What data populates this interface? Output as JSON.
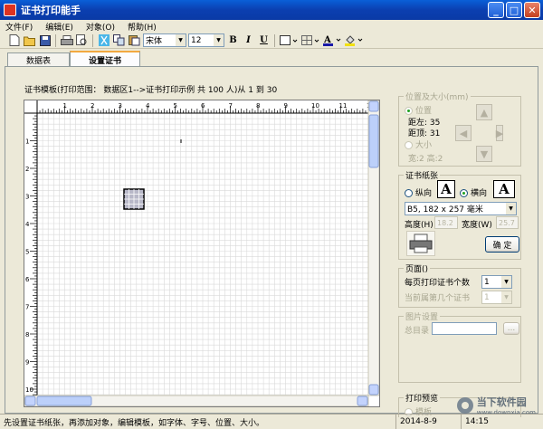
{
  "window": {
    "title": "证书打印能手"
  },
  "menu": [
    "文件(F)",
    "编辑(E)",
    "对象(O)",
    "帮助(H)"
  ],
  "toolbar": {
    "font_name": "宋体",
    "font_size": "12",
    "bold": "B",
    "italic": "I",
    "underline": "U",
    "font_color": "A"
  },
  "tabs": [
    {
      "label": "数据表"
    },
    {
      "label": "设置证书"
    }
  ],
  "template_info": "证书模板(打印范围： 数据区1-->证书打印示例 共 100 人)从 1 到 30",
  "ruler": {
    "h": [
      "1",
      "2",
      "3",
      "4",
      "5",
      "6",
      "7",
      "8",
      "9",
      "10",
      "11",
      "12"
    ],
    "v": [
      "1",
      "2",
      "3",
      "4",
      "5",
      "6",
      "7",
      "8",
      "9",
      "10"
    ]
  },
  "position_group": {
    "title": "位置及大小(mm)",
    "position_label": "位置",
    "left_label": "距左: 35",
    "top_label": "距顶: 31",
    "size_label": "大小",
    "size_value": "宽:2 高:2"
  },
  "paper_group": {
    "title": "证书纸张",
    "portrait_label": "纵向",
    "landscape_label": "横向",
    "paper_size": "B5, 182 x 257 毫米",
    "height_label": "高度(H)",
    "height_value": "18.2",
    "width_label": "宽度(W)",
    "width_value": "25.7",
    "ok_label": "确 定"
  },
  "page_group": {
    "title": "页面()",
    "per_page_label": "每页打印证书个数",
    "per_page_value": "1",
    "current_label": "当前属第几个证书",
    "current_value": "1"
  },
  "image_group": {
    "title": "图片设置",
    "dir_label": "总目录",
    "dir_value": "",
    "browse_label": "..."
  },
  "preview_group": {
    "title": "打印预览",
    "option": "模板"
  },
  "status": {
    "hint": "先设置证书纸张，再添加对象，编辑模板，如字体、字号、位置、大小。",
    "date": "2014-8-9",
    "time": "14:15"
  },
  "watermark": {
    "text": "当下软件园",
    "url": "www.downxia.com"
  },
  "colors": {
    "title_bar": "#0b47c5",
    "window_bg": "#ece9d8",
    "grid": "#d9d9d9",
    "accent_tab": "#f2a940"
  }
}
